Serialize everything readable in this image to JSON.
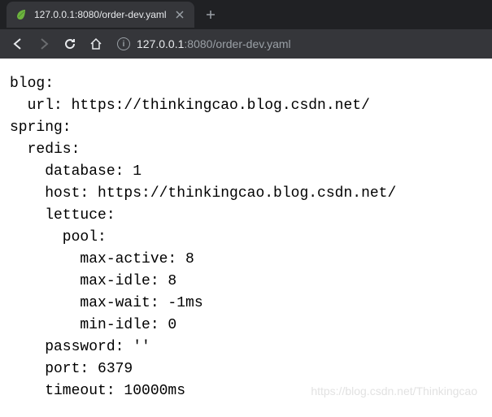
{
  "browser": {
    "tab": {
      "title": "127.0.0.1:8080/order-dev.yaml",
      "favicon": "spring-leaf"
    },
    "url": {
      "host": "127.0.0.1",
      "port": ":8080",
      "path": "/order-dev.yaml"
    }
  },
  "yaml": {
    "l01": "blog:",
    "l02": "  url: https://thinkingcao.blog.csdn.net/",
    "l03": "spring:",
    "l04": "  redis:",
    "l05": "    database: 1",
    "l06": "    host: https://thinkingcao.blog.csdn.net/",
    "l07": "    lettuce:",
    "l08": "      pool:",
    "l09": "        max-active: 8",
    "l10": "        max-idle: 8",
    "l11": "        max-wait: -1ms",
    "l12": "        min-idle: 0",
    "l13": "    password: ''",
    "l14": "    port: 6379",
    "l15": "    timeout: 10000ms"
  },
  "watermark": "https://blog.csdn.net/Thinkingcao"
}
